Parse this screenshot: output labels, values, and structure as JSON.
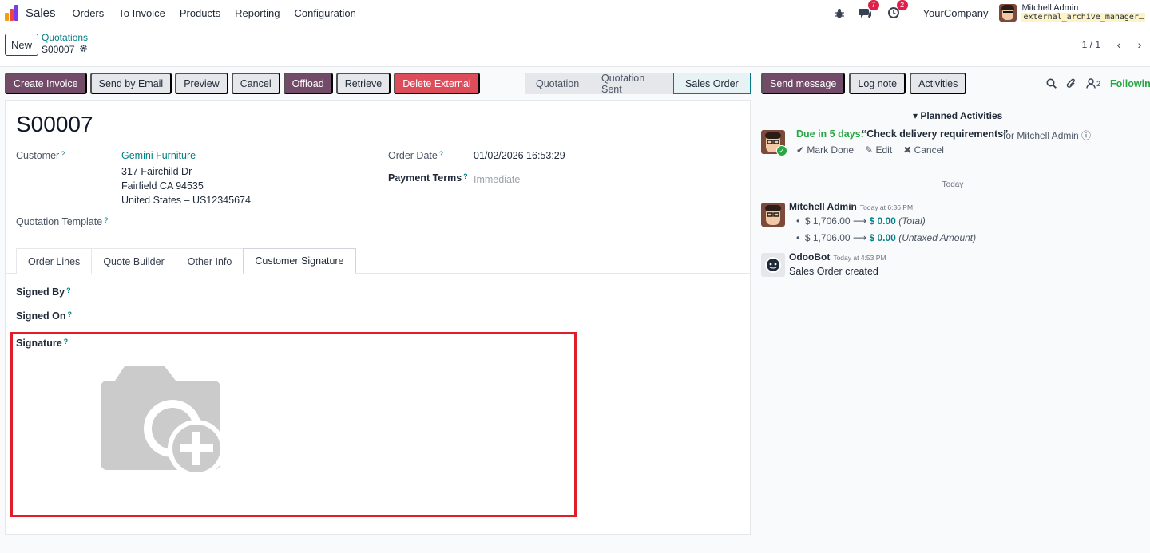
{
  "navbar": {
    "app_name": "Sales",
    "menu": [
      "Orders",
      "To Invoice",
      "Products",
      "Reporting",
      "Configuration"
    ],
    "messages_count": "7",
    "activities_count": "2",
    "company": "YourCompany",
    "user_name": "Mitchell Admin",
    "database": "external_archive_manager…"
  },
  "control": {
    "new_label": "New",
    "breadcrumb_parent": "Quotations",
    "breadcrumb_current": "S00007",
    "pager_value": "1 / 1"
  },
  "actions": {
    "create_invoice": "Create Invoice",
    "send_email": "Send by Email",
    "preview": "Preview",
    "cancel": "Cancel",
    "offload": "Offload",
    "retrieve": "Retrieve",
    "delete_external": "Delete External"
  },
  "statusbar": {
    "stages": [
      "Quotation",
      "Quotation Sent",
      "Sales Order"
    ],
    "active": "Sales Order"
  },
  "form": {
    "reference": "S00007",
    "customer_label": "Customer",
    "customer_name": "Gemini Furniture",
    "address_line1": "317 Fairchild Dr",
    "address_line2": "Fairfield CA 94535",
    "address_line3": "United States – US12345674",
    "order_date_label": "Order Date",
    "order_date": "01/02/2026 16:53:29",
    "payment_terms_label": "Payment Terms",
    "payment_terms_placeholder": "Immediate",
    "quotation_template_label": "Quotation Template",
    "help_mark": "?",
    "tabs": [
      "Order Lines",
      "Quote Builder",
      "Other Info",
      "Customer Signature"
    ],
    "active_tab": "Customer Signature",
    "signed_by_label": "Signed By",
    "signed_on_label": "Signed On",
    "signature_label": "Signature"
  },
  "chatter": {
    "send_message": "Send message",
    "log_note": "Log note",
    "activities": "Activities",
    "followers_count": "2",
    "following": "Following",
    "planned_activities": "Planned Activities",
    "activity": {
      "due": "Due in 5 days:",
      "summary": "“Check delivery requirements”",
      "for": "for Mitchell Admin",
      "mark_done": "Mark Done",
      "edit": "Edit",
      "cancel": "Cancel"
    },
    "today": "Today",
    "messages": [
      {
        "author": "Mitchell Admin",
        "date": "Today at 6:36 PM",
        "tracking": [
          {
            "old": "$ 1,706.00",
            "new": "$ 0.00",
            "field": "(Total)"
          },
          {
            "old": "$ 1,706.00",
            "new": "$ 0.00",
            "field": "(Untaxed Amount)"
          }
        ]
      },
      {
        "author": "OdooBot",
        "date": "Today at 4:53 PM",
        "body": "Sales Order created"
      }
    ]
  },
  "colors": {
    "primary": "#714b67",
    "link": "#017e84",
    "danger": "#dc4c5a",
    "success": "#28a745",
    "highlight_box": "#e11d2a"
  }
}
